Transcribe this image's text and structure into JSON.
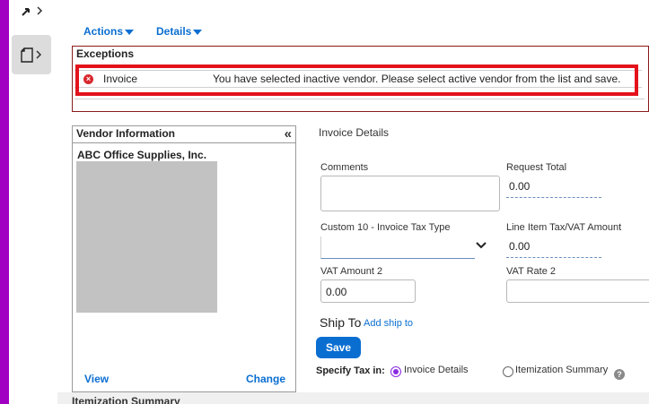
{
  "menu": {
    "actions_label": "Actions",
    "details_label": "Details"
  },
  "exceptions": {
    "title": "Exceptions",
    "rows": [
      {
        "type": "Invoice",
        "message": "You have selected inactive vendor. Please select active vendor from the list and save."
      }
    ]
  },
  "vendor": {
    "header": "Vendor Information",
    "name": "ABC Office Supplies, Inc.",
    "view_label": "View",
    "change_label": "Change"
  },
  "invoice_details": {
    "title": "Invoice Details",
    "comments_label": "Comments",
    "comments_value": "",
    "request_total_label": "Request Total",
    "request_total_value": "0.00",
    "tax_type_label": "Custom 10 - Invoice Tax Type",
    "tax_type_value": "",
    "line_item_tax_label": "Line Item Tax/VAT Amount",
    "line_item_tax_value": "0.00",
    "vat_amount2_label": "VAT Amount 2",
    "vat_amount2_value": "0.00",
    "vat_rate2_label": "VAT Rate 2",
    "vat_rate2_value": ""
  },
  "ship_to": {
    "label": "Ship To",
    "add_link": "Add ship to"
  },
  "save_label": "Save",
  "tax": {
    "label": "Specify Tax in:",
    "options": [
      {
        "label": "Invoice Details",
        "selected": true
      },
      {
        "label": "Itemization Summary",
        "selected": false
      }
    ]
  },
  "itemization_title": "Itemization Summary",
  "colors": {
    "accent": "#0a6ed1",
    "brand_bar": "#a100c2",
    "error": "#d8272d",
    "highlight": "#e3121b"
  }
}
